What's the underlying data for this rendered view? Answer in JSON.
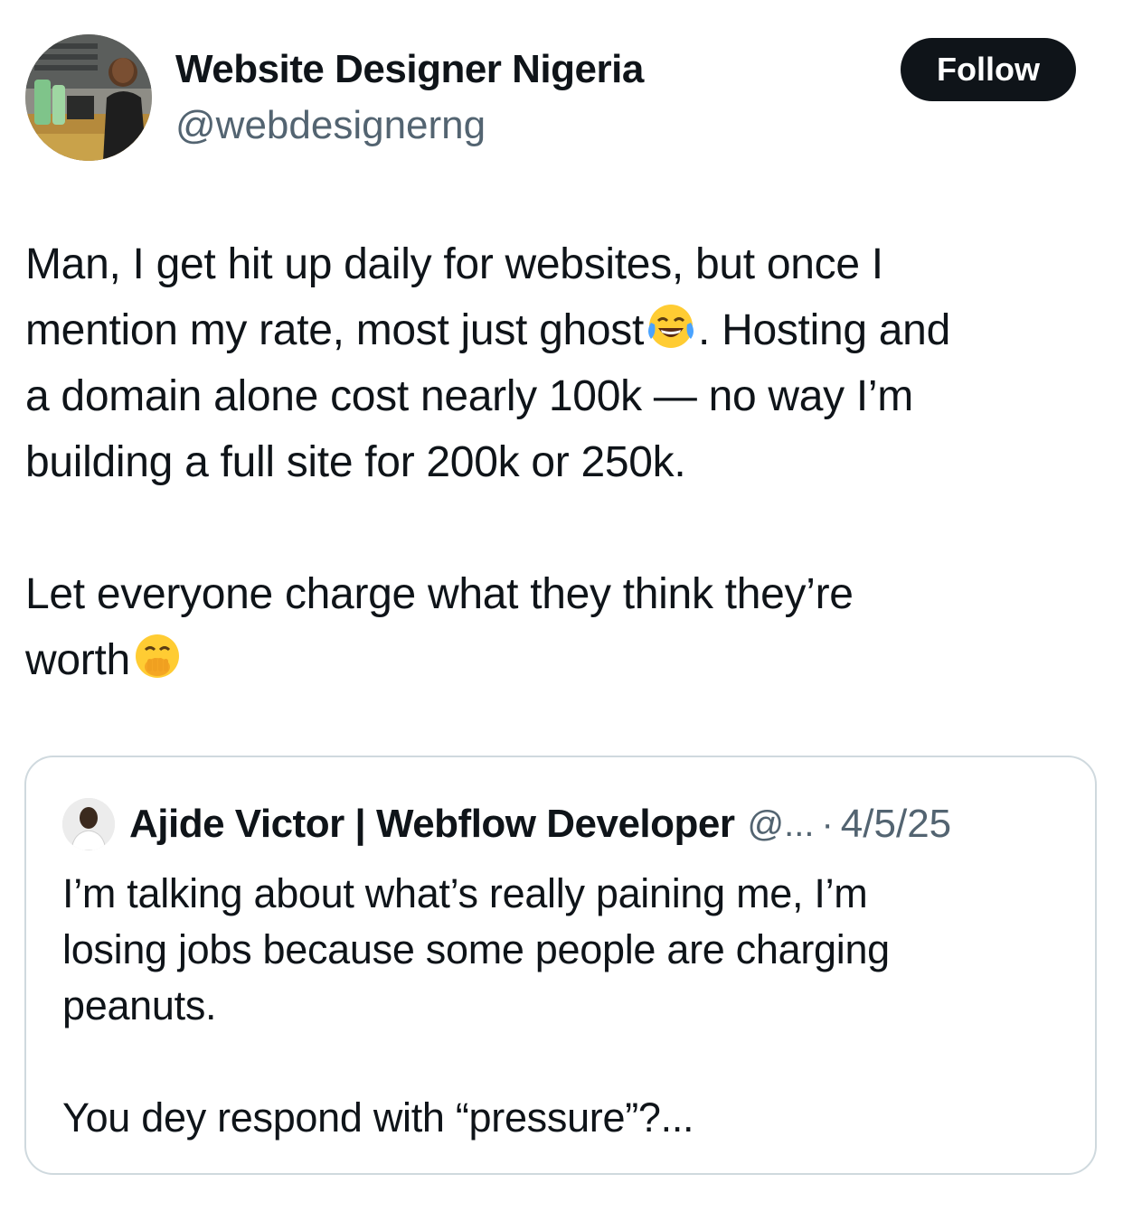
{
  "author": {
    "name": "Website Designer Nigeria",
    "handle": "@webdesignerng"
  },
  "follow_label": "Follow",
  "tweet": {
    "line1": "Man, I get hit up daily for websites, but once I",
    "line2a": "mention my rate, most just ghost",
    "line2b": ". Hosting and",
    "line3": "a domain alone cost nearly 100k — no way I’m",
    "line4": "building a full site for 200k or 250k.",
    "line5": "Let everyone charge what they think they’re",
    "line6a": "worth",
    "emoji1": "face-with-tears-of-joy-icon",
    "emoji2": "face-with-hand-over-mouth-icon"
  },
  "quote": {
    "name": "Ajide Victor | Webflow Developer",
    "handle": "@...",
    "separator": "·",
    "date": "4/5/25",
    "line1": "I’m talking about what’s really paining me, I’m",
    "line2": "losing jobs because some people are charging",
    "line3": "peanuts.",
    "line4": "You dey respond with “pressure”?..."
  },
  "colors": {
    "text": "#0f1419",
    "secondary": "#536471",
    "border": "#cfd9de",
    "follow_bg": "#0f1419",
    "follow_text": "#ffffff"
  }
}
